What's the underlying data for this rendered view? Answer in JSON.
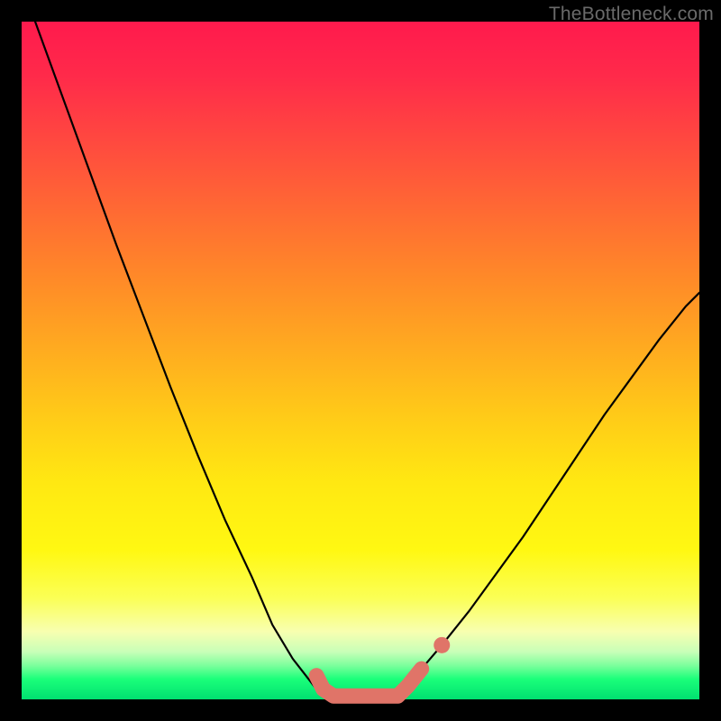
{
  "watermark": "TheBottleneck.com",
  "chart_data": {
    "type": "line",
    "title": "",
    "xlabel": "",
    "ylabel": "",
    "xlim": [
      0,
      100
    ],
    "ylim": [
      0,
      100
    ],
    "grid": false,
    "legend": false,
    "series": [
      {
        "name": "left-curve",
        "color": "#000000",
        "x": [
          2,
          6,
          10,
          14,
          18,
          22,
          26,
          30,
          34,
          37,
          40,
          43.5,
          44.5
        ],
        "values": [
          100,
          89,
          78,
          67,
          56.5,
          46,
          36,
          26.5,
          18,
          11,
          6,
          1.5,
          0.5
        ]
      },
      {
        "name": "right-curve",
        "color": "#000000",
        "x": [
          55.5,
          57,
          59,
          62,
          66,
          70,
          74,
          78,
          82,
          86,
          90,
          94,
          98,
          100
        ],
        "values": [
          0.5,
          2,
          4.5,
          8,
          13,
          18.5,
          24,
          30,
          36,
          42,
          47.5,
          53,
          58,
          60
        ]
      },
      {
        "name": "highlight-segment",
        "color": "#e07468",
        "x": [
          43.5,
          44.5,
          46,
          52,
          53.5,
          55.5,
          57,
          59
        ],
        "values": [
          3.5,
          1.5,
          0.5,
          0.5,
          0.5,
          0.5,
          2,
          4.5
        ]
      },
      {
        "name": "highlight-dot",
        "color": "#e07468",
        "x": [
          62
        ],
        "values": [
          8
        ]
      }
    ]
  }
}
